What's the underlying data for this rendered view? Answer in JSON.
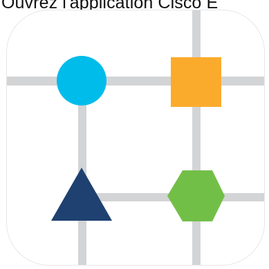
{
  "caption": "Ouvrez l'application Cisco E",
  "icon": {
    "name": "app-icon",
    "colors": {
      "background": "#ffffff",
      "grid_line": "#d3d4d6",
      "circle": "#00bceb",
      "square": "#fbab2c",
      "triangle": "#1f4171",
      "hexagon": "#72bf48"
    }
  }
}
